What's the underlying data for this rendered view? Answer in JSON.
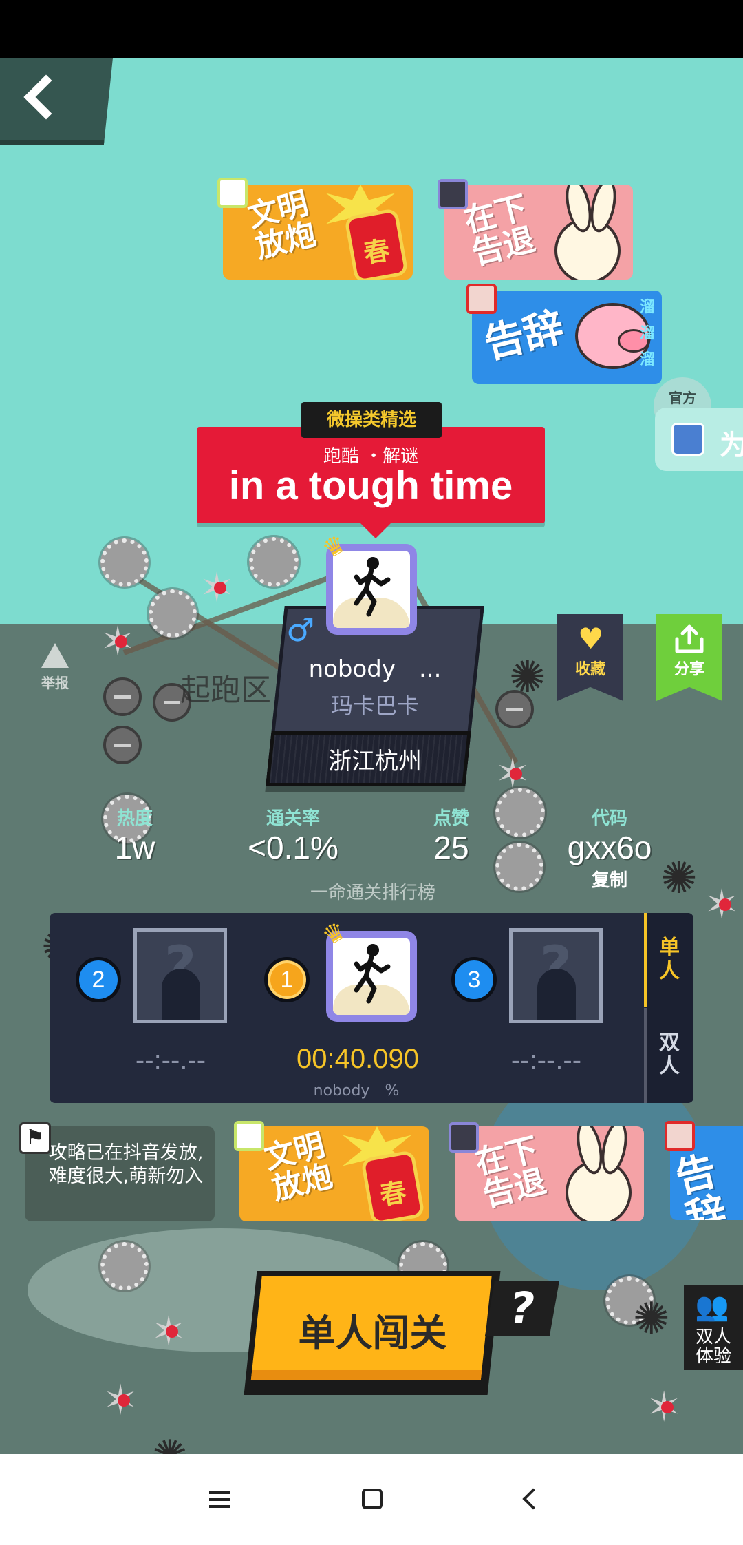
{
  "level": {
    "tag": "微操类精选",
    "category": "跑酷 ・解谜",
    "name": "in a tough time",
    "start_zone": "起跑区"
  },
  "official": "官方\n抖音",
  "side_chip_text": "为",
  "stickers": {
    "firecracker_text": "文明\n放炮",
    "firecracker_char": "春",
    "farewell_text": "在下\n告退",
    "goodbye_text": "告辞",
    "swirl_text": "溜\n溜\n溜"
  },
  "author": {
    "name": "nobody　...",
    "nickname": "玛卡巴卡",
    "location": "浙江杭州",
    "gender_symbol": "♂"
  },
  "actions": {
    "favorite_label": "收藏",
    "share_label": "分享",
    "report_label": "举报",
    "back_icon": "chevron-left-icon"
  },
  "stats": [
    {
      "label": "热度",
      "value": "1w"
    },
    {
      "label": "通关率",
      "value": "<0.1%"
    },
    {
      "label": "点赞",
      "value": "25"
    },
    {
      "label": "代码",
      "value": "gxx6o"
    }
  ],
  "copy_label": "复制",
  "ranking": {
    "title": "一命通关排行榜",
    "tabs": [
      "单\n人",
      "双\n人"
    ],
    "entries": [
      {
        "rank": "2",
        "time": "--:--.--"
      },
      {
        "rank": "1",
        "time": "00:40.090",
        "player": "nobody　%"
      },
      {
        "rank": "3",
        "time": "--:--.--"
      }
    ]
  },
  "tip": "攻略已在抖音发放,难度很大,萌新勿入",
  "buttons": {
    "play_solo": "单人闯关",
    "help": "?",
    "duo_trial": "双人\n体验"
  },
  "colors": {
    "sky": "#7ddccf",
    "banner_red": "#e51a37",
    "gold": "#f6c427",
    "share_green": "#6fcf3c",
    "panel_navy": "#23293c"
  }
}
